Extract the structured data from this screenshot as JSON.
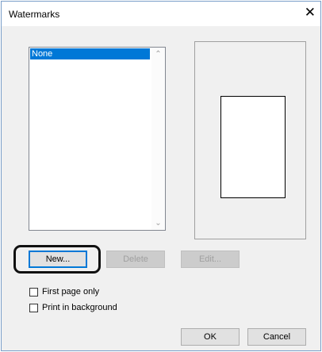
{
  "dialog": {
    "title": "Watermarks",
    "close_glyph": "✕"
  },
  "list": {
    "items": [
      "None"
    ],
    "selected": "None",
    "scroll_up_glyph": "⌃",
    "scroll_down_glyph": "⌄"
  },
  "buttons": {
    "new": "New...",
    "delete": "Delete",
    "edit": "Edit...",
    "ok": "OK",
    "cancel": "Cancel"
  },
  "options": {
    "first_page_only": {
      "label": "First page only",
      "checked": false
    },
    "print_in_background": {
      "label": "Print in background",
      "checked": false
    }
  },
  "icons": {
    "close": "close-icon",
    "scroll_up": "chevron-up-icon",
    "scroll_down": "chevron-down-icon"
  }
}
